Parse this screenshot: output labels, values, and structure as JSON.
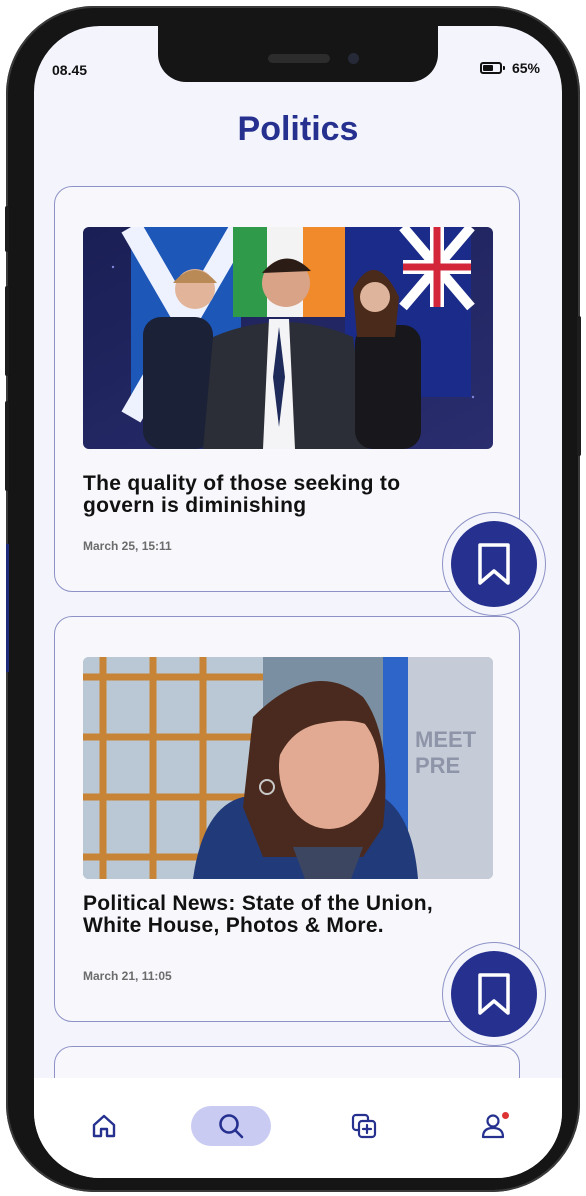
{
  "status_bar": {
    "time": "08.45",
    "battery_percent": "65%"
  },
  "page": {
    "title": "Politics"
  },
  "articles": [
    {
      "title": "The quality of those seeking to govern is diminishing",
      "date": "March 25, 15:11",
      "image": "politicians-with-flags-photo"
    },
    {
      "title": "Political News: State of the Union, White House, Photos & More.",
      "date": "March 21, 11:05",
      "image": "woman-speaking-on-tv-photo"
    }
  ],
  "bottom_nav": {
    "items": [
      {
        "name": "home",
        "icon": "home-icon",
        "active": false
      },
      {
        "name": "search",
        "icon": "search-icon",
        "active": true
      },
      {
        "name": "add",
        "icon": "add-post-icon",
        "active": false
      },
      {
        "name": "profile",
        "icon": "profile-icon",
        "active": false,
        "notification": true
      }
    ]
  },
  "colors": {
    "accent": "#26318f",
    "background": "#f4f5fc",
    "card_border": "#8d92c6",
    "active_nav": "#c9cbf3"
  }
}
